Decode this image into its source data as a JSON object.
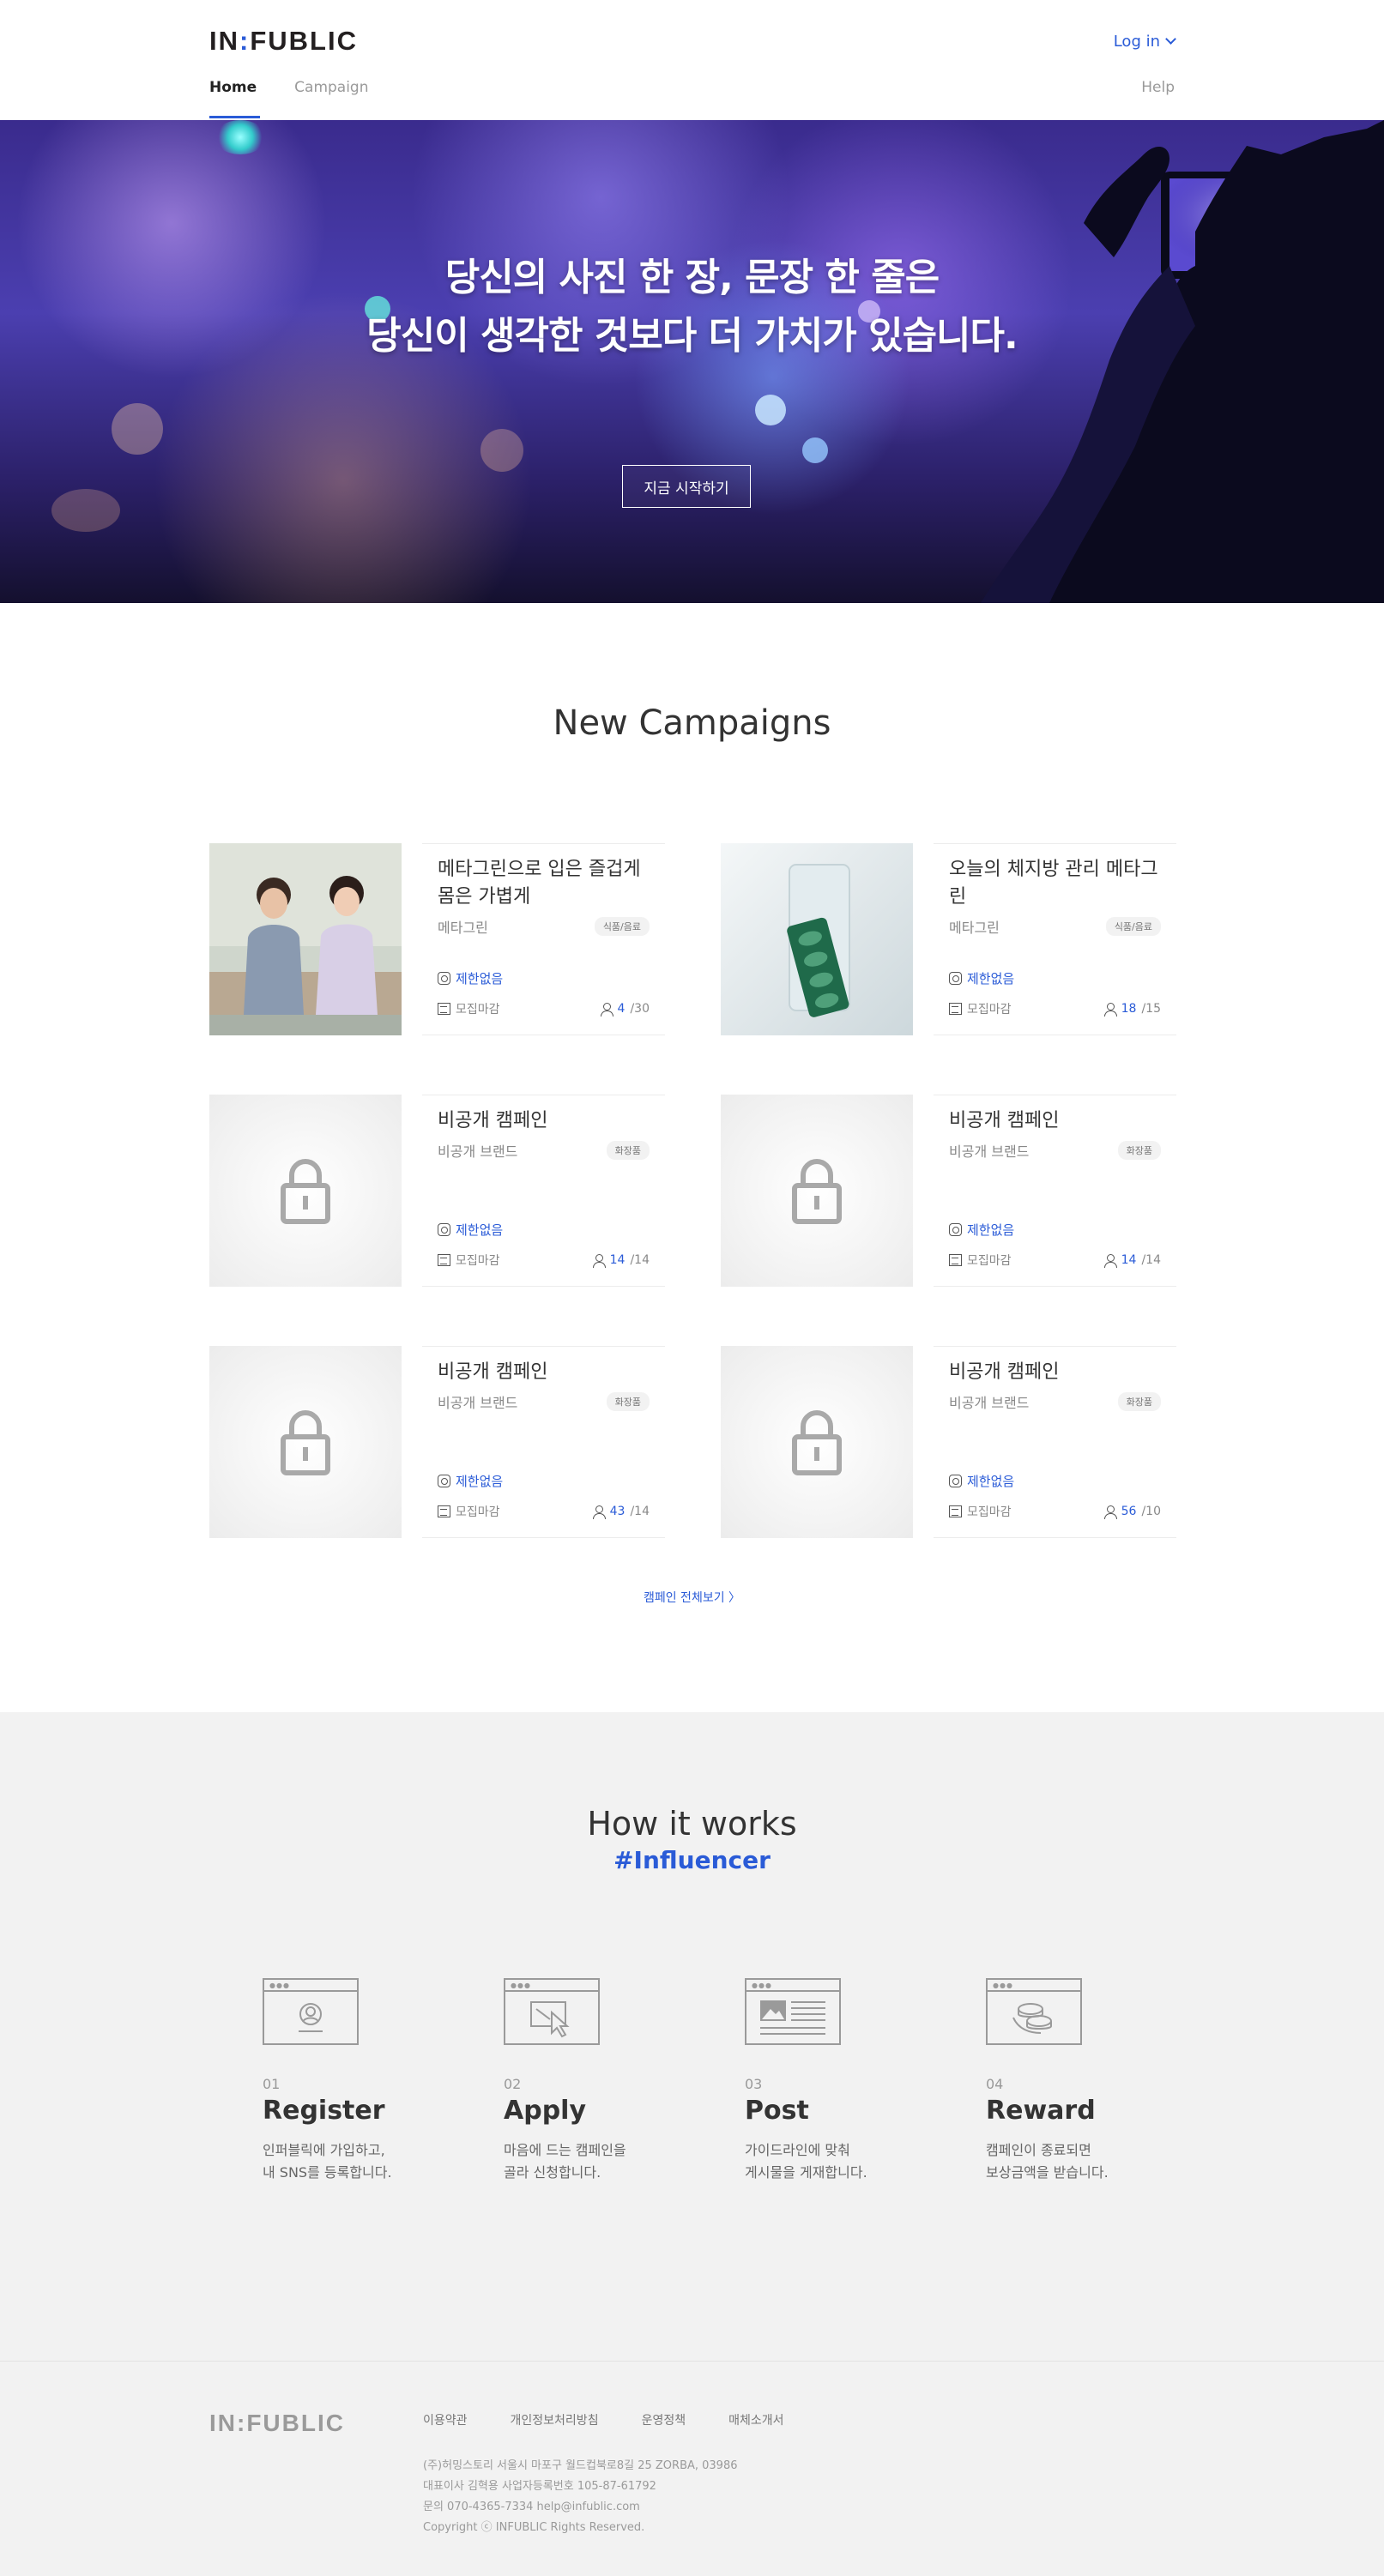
{
  "header": {
    "logo_left": "IN",
    "logo_colon": ":",
    "logo_right": "FUBLIC",
    "login_label": "Log in",
    "nav": [
      {
        "label": "Home",
        "active": true
      },
      {
        "label": "Campaign",
        "active": false
      }
    ],
    "help_label": "Help"
  },
  "hero": {
    "title_line1": "당신의 사진 한 장, 문장 한 줄은",
    "title_line2": "당신이 생각한 것보다 더 가치가 있습니다.",
    "cta_label": "지금 시작하기"
  },
  "campaigns": {
    "section_title": "New Campaigns",
    "items": [
      {
        "title": "메타그린으로 입은 즐겁게 몸은 가볍게",
        "brand": "메타그린",
        "tag": "식품/음료",
        "limit": "제한없음",
        "status": "모집마감",
        "applied": "4",
        "capacity": "/30",
        "thumb": "couple"
      },
      {
        "title": "오늘의 체지방 관리 메타그린",
        "brand": "메타그린",
        "tag": "식품/음료",
        "limit": "제한없음",
        "status": "모집마감",
        "applied": "18",
        "capacity": "/15",
        "thumb": "pills"
      },
      {
        "title": "비공개 캠페인",
        "brand": "비공개 브랜드",
        "tag": "화장품",
        "limit": "제한없음",
        "status": "모집마감",
        "applied": "14",
        "capacity": "/14",
        "thumb": "lock"
      },
      {
        "title": "비공개 캠페인",
        "brand": "비공개 브랜드",
        "tag": "화장품",
        "limit": "제한없음",
        "status": "모집마감",
        "applied": "14",
        "capacity": "/14",
        "thumb": "lock"
      },
      {
        "title": "비공개 캠페인",
        "brand": "비공개 브랜드",
        "tag": "화장품",
        "limit": "제한없음",
        "status": "모집마감",
        "applied": "43",
        "capacity": "/14",
        "thumb": "lock"
      },
      {
        "title": "비공개 캠페인",
        "brand": "비공개 브랜드",
        "tag": "화장품",
        "limit": "제한없음",
        "status": "모집마감",
        "applied": "56",
        "capacity": "/10",
        "thumb": "lock"
      }
    ],
    "see_all": "캠페인 전체보기 〉"
  },
  "how": {
    "title": "How it works",
    "subtitle": "#Influencer",
    "steps": [
      {
        "num": "01",
        "name": "Register",
        "desc1": "인퍼블릭에 가입하고,",
        "desc2": "내 SNS를 등록합니다.",
        "icon": "user-icon"
      },
      {
        "num": "02",
        "name": "Apply",
        "desc1": "마음에 드는 캠페인을",
        "desc2": "골라 신청합니다.",
        "icon": "cursor-icon"
      },
      {
        "num": "03",
        "name": "Post",
        "desc1": "가이드라인에 맞춰",
        "desc2": "게시물을 게재합니다.",
        "icon": "article-icon"
      },
      {
        "num": "04",
        "name": "Reward",
        "desc1": "캠페인이 종료되면",
        "desc2": "보상금액을 받습니다.",
        "icon": "coins-icon"
      }
    ]
  },
  "footer": {
    "logo": "IN:FUBLIC",
    "links": [
      "이용약관",
      "개인정보처리방침",
      "운영정책",
      "매체소개서"
    ],
    "info": [
      "(주)허밍스토리 서울시 마포구 월드컵북로8길 25 ZORBA, 03986",
      "대표이사 김혁용    사업자등록번호 105-87-61792",
      "문의 070-4365-7334    help@infublic.com",
      "Copyright ⓒ INFUBLIC Rights Reserved."
    ]
  },
  "colors": {
    "accent": "#2a5bd7",
    "section_bg": "#f2f2f2"
  }
}
